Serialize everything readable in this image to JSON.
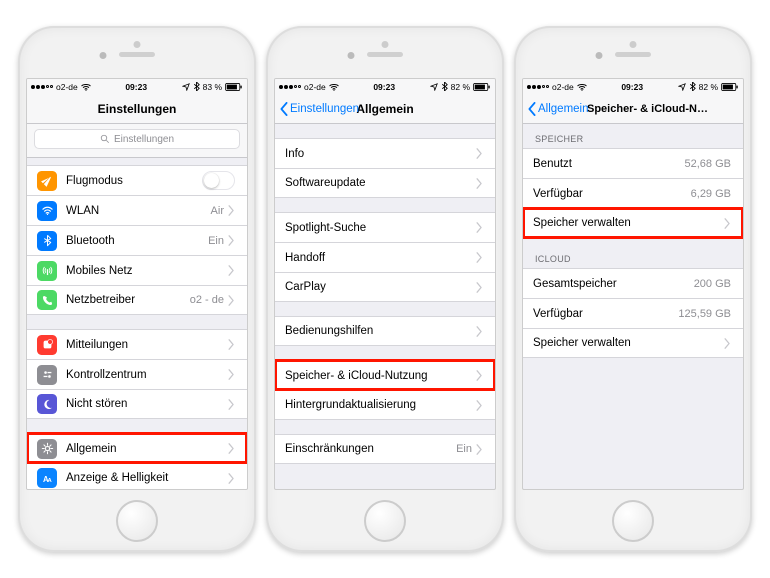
{
  "status": {
    "carrier": "o2-de",
    "time": "09:23",
    "battery": "83 %"
  },
  "phone1": {
    "title": "Einstellungen",
    "search_placeholder": "Einstellungen",
    "rows": {
      "airplane": "Flugmodus",
      "wifi": "WLAN",
      "wifi_val": "Air",
      "bt": "Bluetooth",
      "bt_val": "Ein",
      "cell": "Mobiles Netz",
      "carrier": "Netzbetreiber",
      "carrier_val": "o2 - de",
      "notif": "Mitteilungen",
      "control": "Kontrollzentrum",
      "dnd": "Nicht stören",
      "general": "Allgemein",
      "display": "Anzeige & Helligkeit"
    }
  },
  "phone2": {
    "back": "Einstellungen",
    "title": "Allgemein",
    "rows": {
      "info": "Info",
      "swupdate": "Softwareupdate",
      "spotlight": "Spotlight-Suche",
      "handoff": "Handoff",
      "carplay": "CarPlay",
      "access": "Bedienungshilfen",
      "storage": "Speicher- & iCloud-Nutzung",
      "bgrefresh": "Hintergrundaktualisierung",
      "restrict": "Einschränkungen",
      "restrict_val": "Ein"
    }
  },
  "phone3": {
    "back": "Allgemein",
    "title": "Speicher- & iCloud-Nutzung",
    "sections": {
      "storage": "SPEICHER",
      "icloud": "ICLOUD"
    },
    "rows": {
      "used": "Benutzt",
      "used_val": "52,68 GB",
      "avail": "Verfügbar",
      "avail_val": "6,29 GB",
      "manage": "Speicher verwalten",
      "ic_total": "Gesamtspeicher",
      "ic_total_val": "200 GB",
      "ic_avail": "Verfügbar",
      "ic_avail_val": "125,59 GB",
      "ic_manage": "Speicher verwalten"
    }
  }
}
